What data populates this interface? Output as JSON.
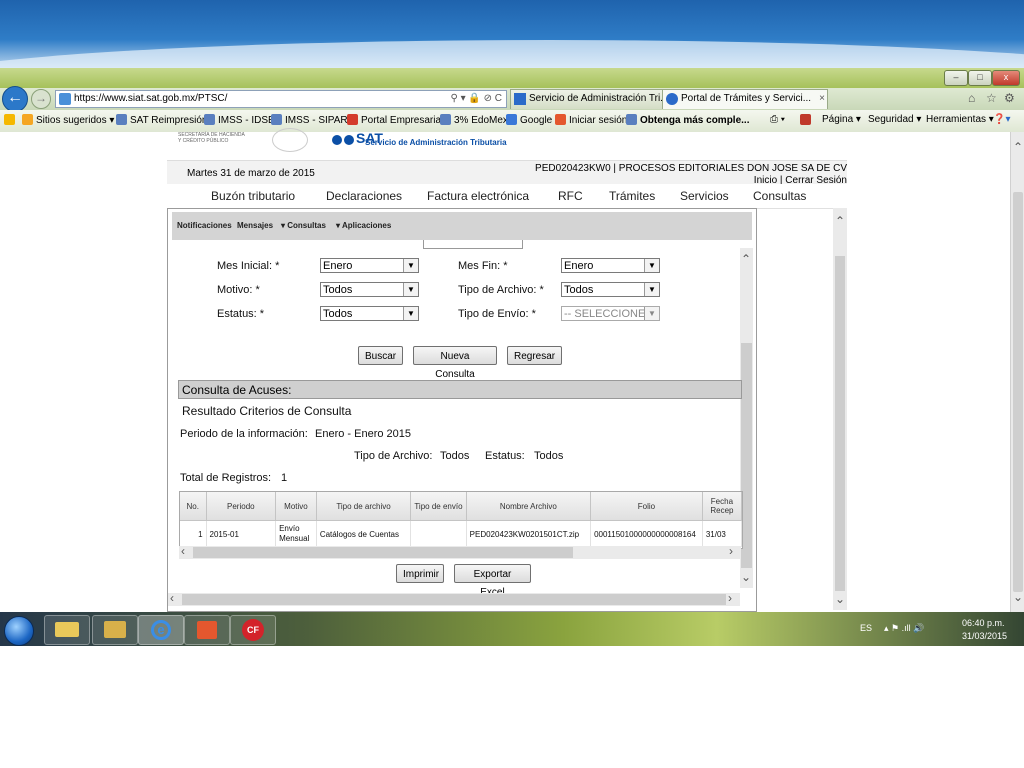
{
  "browser": {
    "address": "https://www.siat.sat.gob.mx/PTSC/",
    "tabs": [
      {
        "label": "Servicio de Administración Tri..."
      },
      {
        "label": "Portal de Trámites y Servici..."
      }
    ],
    "tab_close": "×",
    "window_buttons": {
      "minimize": "–",
      "maximize": "□",
      "close": "x"
    },
    "favorites": [
      {
        "label": "Sitios sugeridos ▾",
        "color": "#f5a623"
      },
      {
        "label": "SAT Reimpresión",
        "color": "#5a7fbf"
      },
      {
        "label": "IMSS - IDSE",
        "color": "#5a7fbf"
      },
      {
        "label": "IMSS - SIPARE",
        "color": "#5a7fbf"
      },
      {
        "label": "Portal Empresarial",
        "color": "#d43c2c"
      },
      {
        "label": "3% EdoMex",
        "color": "#5a7fbf"
      },
      {
        "label": "Google",
        "color": "#3a78d8"
      },
      {
        "label": "Iniciar sesión",
        "color": "#e4572e"
      },
      {
        "label": "Obtenga más comple...",
        "color": "#5a7fbf"
      }
    ],
    "command_bar": [
      "Página ▾",
      "Seguridad ▾",
      "Herramientas ▾"
    ]
  },
  "sat": {
    "agency_line1": "SECRETARÍA DE HACIENDA",
    "agency_line2": "Y CRÉDITO PÚBLICO",
    "brand": "SAT",
    "brand_sub": "Servicio de Administración Tributaria",
    "date": "Martes 31 de marzo de 2015",
    "user": "PED020423KW0 | PROCESOS EDITORIALES DON JOSE SA DE CV",
    "links": "Inicio | Cerrar Sesión",
    "nav": [
      "Buzón tributario",
      "Declaraciones",
      "Factura electrónica",
      "RFC",
      "Trámites",
      "Servicios",
      "Consultas"
    ],
    "subnav": [
      "Notificaciones",
      "Mensajes",
      "Consultas",
      "Aplicaciones"
    ]
  },
  "form": {
    "mes_inicial_label": "Mes Inicial: *",
    "mes_inicial_value": "Enero",
    "mes_fin_label": "Mes Fin: *",
    "mes_fin_value": "Enero",
    "motivo_label": "Motivo: *",
    "motivo_value": "Todos",
    "tipo_archivo_label": "Tipo de Archivo: *",
    "tipo_archivo_value": "Todos",
    "estatus_label": "Estatus: *",
    "estatus_value": "Todos",
    "tipo_envio_label": "Tipo de Envío: *",
    "tipo_envio_value": "-- SELECCIONE",
    "buttons": {
      "buscar": "Buscar",
      "nueva": "Nueva Consulta",
      "regresar": "Regresar"
    }
  },
  "results": {
    "section_title": "Consulta de Acuses:",
    "subtitle": "Resultado Criterios de Consulta",
    "periodo_label": "Periodo de la información:",
    "periodo_value": "Enero - Enero  2015",
    "tipo_archivo_label": "Tipo de Archivo:",
    "tipo_archivo_value": "Todos",
    "estatus_label": "Estatus:",
    "estatus_value": "Todos",
    "total_label": "Total de Registros:",
    "total_value": "1",
    "columns": [
      "No.",
      "Periodo",
      "Motivo",
      "Tipo de archivo",
      "Tipo de envío",
      "Nombre Archivo",
      "Folio",
      "Fecha Recep"
    ],
    "rows": [
      [
        "1",
        "2015-01",
        "Envío Mensual",
        "Catálogos de Cuentas",
        "",
        "PED020423KW0201501CT.zip",
        "00011501000000000008164",
        "31/03"
      ]
    ],
    "buttons": {
      "imprimir": "Imprimir",
      "exportar": "Exportar Excel"
    }
  },
  "taskbar": {
    "lang": "ES",
    "time": "06:40 p.m.",
    "date": "31/03/2015"
  }
}
